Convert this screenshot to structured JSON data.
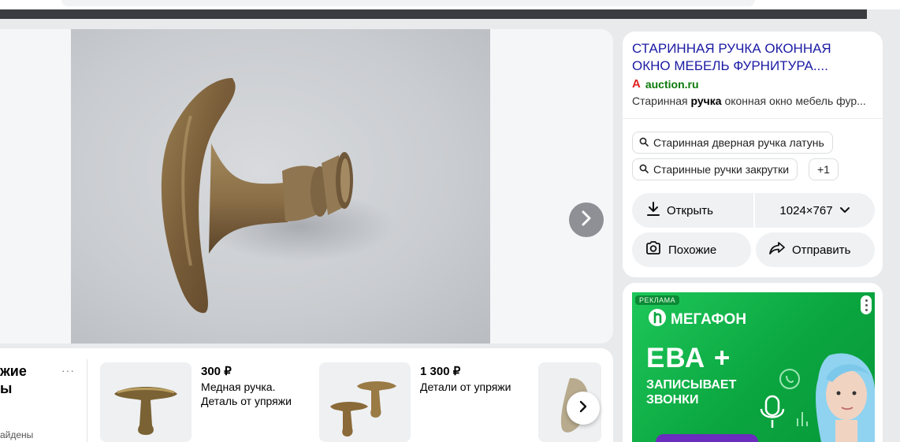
{
  "topbar": {},
  "viewer": {
    "next_label": "Следующее изображение"
  },
  "panel": {
    "title": "СТАРИННАЯ РУЧКА ОКОННАЯ ОКНО МЕБЕЛЬ ФУРНИТУРА....",
    "source_host": "auction.ru",
    "source_logo": "A",
    "desc_before": "Старинная ",
    "desc_bold": "ручка",
    "desc_after": " оконная окно мебель фур...",
    "chips": [
      {
        "label": "Старинная дверная ручка латунь"
      },
      {
        "label": "Старинные ручки закрутки"
      },
      {
        "label": "+1"
      }
    ],
    "actions": {
      "open": "Открыть",
      "size": "1024×767",
      "similar": "Похожие",
      "share": "Отправить"
    }
  },
  "similar": {
    "title_line1": "жие",
    "title_line2": "ы",
    "subtitle": "айдены",
    "more": "···",
    "cards": [
      {
        "price": "300 ₽",
        "desc": "Медная ручка. Деталь от упряжи"
      },
      {
        "price": "1 300 ₽",
        "desc": "Детали от упряжи"
      }
    ]
  },
  "ad": {
    "label": "РЕКЛАМА",
    "brand": "МЕГАФОН",
    "headline": "ЕВА +",
    "text": "ЗАПИСЫВАЕТ ЗВОНКИ"
  },
  "colors": {
    "title_link": "#1b1ba4",
    "host_green": "#0a7a0a",
    "ad_green": "#0ba640",
    "ad_purple": "#6b2dbe"
  }
}
